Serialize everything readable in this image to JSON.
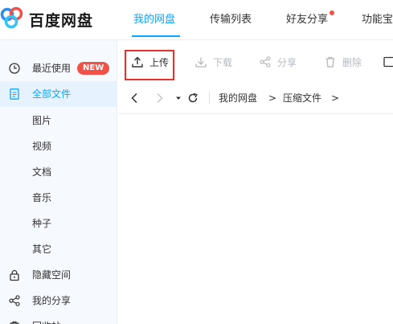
{
  "brand": {
    "name": "百度网盘"
  },
  "header": {
    "tabs": [
      {
        "label": "我的网盘",
        "active": true
      },
      {
        "label": "传输列表",
        "active": false
      },
      {
        "label": "好友分享",
        "active": false,
        "has_notification_dot": true
      },
      {
        "label": "功能宝",
        "active": false
      }
    ]
  },
  "sidebar": {
    "items": [
      {
        "label": "最近使用",
        "icon": "clock-icon",
        "badge": "NEW"
      },
      {
        "label": "全部文件",
        "icon": "file-icon",
        "active": true
      },
      {
        "label": "图片"
      },
      {
        "label": "视频"
      },
      {
        "label": "文档"
      },
      {
        "label": "音乐"
      },
      {
        "label": "种子"
      },
      {
        "label": "其它"
      },
      {
        "label": "隐藏空间",
        "icon": "lock-icon"
      },
      {
        "label": "我的分享",
        "icon": "share-icon"
      },
      {
        "label": "回收站",
        "icon": "trash-icon"
      }
    ]
  },
  "toolbar": {
    "upload": "上传",
    "download": "下载",
    "share": "分享",
    "delete": "删除"
  },
  "breadcrumb": {
    "root": "我的网盘",
    "sep1": ">",
    "folder": "压缩文件",
    "sep2": ">"
  },
  "colors": {
    "accent": "#06a7ff",
    "badge": "#f25149",
    "highlight_box": "#e8312c",
    "sidebar_bg": "#f6f9fd"
  }
}
